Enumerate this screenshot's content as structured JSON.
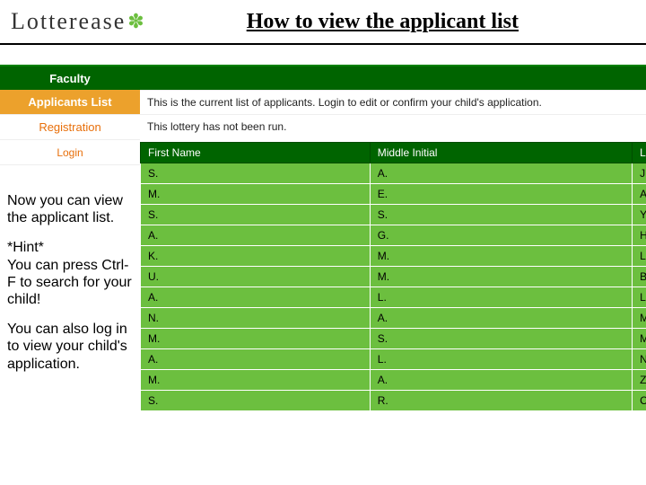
{
  "header": {
    "logo_text": "Lotterease",
    "slide_title": "How to view the applicant list"
  },
  "sidebar": {
    "faculty_label": "Faculty",
    "nav": {
      "applicants": "Applicants List",
      "registration": "Registration",
      "login": "Login"
    }
  },
  "main": {
    "intro": "This is the current list of applicants. Login to edit or confirm your child's application.",
    "status": "This lottery has not been run.",
    "columns": [
      "First Name",
      "Middle Initial",
      "La"
    ],
    "rows": [
      {
        "first": "S.",
        "middle": "A.",
        "last": "J."
      },
      {
        "first": "M.",
        "middle": "E.",
        "last": "A."
      },
      {
        "first": "S.",
        "middle": "S.",
        "last": "Y."
      },
      {
        "first": "A.",
        "middle": "G.",
        "last": "H."
      },
      {
        "first": "K.",
        "middle": "M.",
        "last": "L."
      },
      {
        "first": "U.",
        "middle": "M.",
        "last": "B."
      },
      {
        "first": "A.",
        "middle": "L.",
        "last": "L."
      },
      {
        "first": "N.",
        "middle": "A.",
        "last": "M."
      },
      {
        "first": "M.",
        "middle": "S.",
        "last": "M."
      },
      {
        "first": "A.",
        "middle": "L.",
        "last": "N."
      },
      {
        "first": "M.",
        "middle": "A.",
        "last": "Z."
      },
      {
        "first": "S.",
        "middle": "R.",
        "last": "C."
      }
    ]
  },
  "notes": {
    "p1": "Now you can view the applicant list.",
    "p2_a": "*Hint*",
    "p2_b": "You can press Ctrl-F to search for your child!",
    "p3": "You can also log in to view your child's application."
  }
}
